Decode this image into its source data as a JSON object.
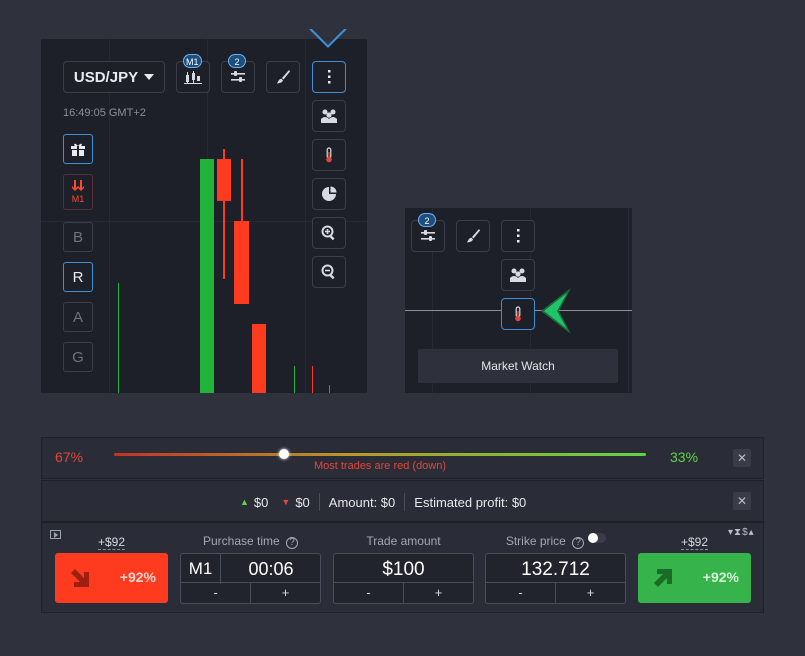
{
  "chart": {
    "pair": "USD/JPY",
    "clock": "16:49:05 GMT+2",
    "toolbar": [
      {
        "name": "candles-button",
        "icon": "candlestick-icon",
        "badge": "M1"
      },
      {
        "name": "indicators-button",
        "icon": "sliders-icon",
        "badge": "2"
      },
      {
        "name": "drawing-button",
        "icon": "brush-icon",
        "badge": ""
      },
      {
        "name": "more-button",
        "icon": "vertical-dots-icon",
        "badge": ""
      }
    ],
    "side_tools": [
      {
        "name": "social-button",
        "icon": "users-icon"
      },
      {
        "name": "market-watch-button",
        "icon": "thermometer-icon"
      },
      {
        "name": "sentiment-button",
        "icon": "pie-chart-icon"
      },
      {
        "name": "zoom-in-button",
        "icon": "zoom-in-icon"
      },
      {
        "name": "zoom-out-button",
        "icon": "zoom-out-icon"
      }
    ],
    "left_buttons": [
      {
        "name": "gift-button",
        "icon": "gift-icon",
        "label": ""
      },
      {
        "name": "signals-button",
        "icon": "down-arrows-icon",
        "label": "M1"
      },
      {
        "name": "mode-b-button",
        "label": "B"
      },
      {
        "name": "mode-r-button",
        "label": "R"
      },
      {
        "name": "mode-a-button",
        "label": "A"
      },
      {
        "name": "mode-g-button",
        "label": "G"
      }
    ],
    "colors": {
      "up": "#22b33a",
      "down": "#ff3b1f",
      "accent": "#3d8fd6"
    }
  },
  "zoom": {
    "badge": "2",
    "tooltip": "Market Watch",
    "arrow_color": "#22c46a"
  },
  "sentiment": {
    "down_pct": "67%",
    "up_pct": "33%",
    "message": "Most trades are red (down)",
    "down_color": "#e1463a",
    "up_color": "#5fd445",
    "slider_fraction": 0.32
  },
  "profit_bar": {
    "up_value": "$0",
    "down_value": "$0",
    "amount": "Amount: $0",
    "estimated": "Estimated profit: $0"
  },
  "trade": {
    "sell_payout": "+$92",
    "buy_payout": "+$92",
    "sell_label": "+92%",
    "buy_label": "+92%",
    "currency_toggle": "$",
    "purchase_time": {
      "label": "Purchase time",
      "unit": "M1",
      "value": "00:06",
      "minus": "-",
      "plus": "+"
    },
    "trade_amount": {
      "label": "Trade amount",
      "value": "$100",
      "minus": "-",
      "plus": "+"
    },
    "strike_price": {
      "label": "Strike price",
      "value": "132.712",
      "minus": "-",
      "plus": "+"
    }
  }
}
